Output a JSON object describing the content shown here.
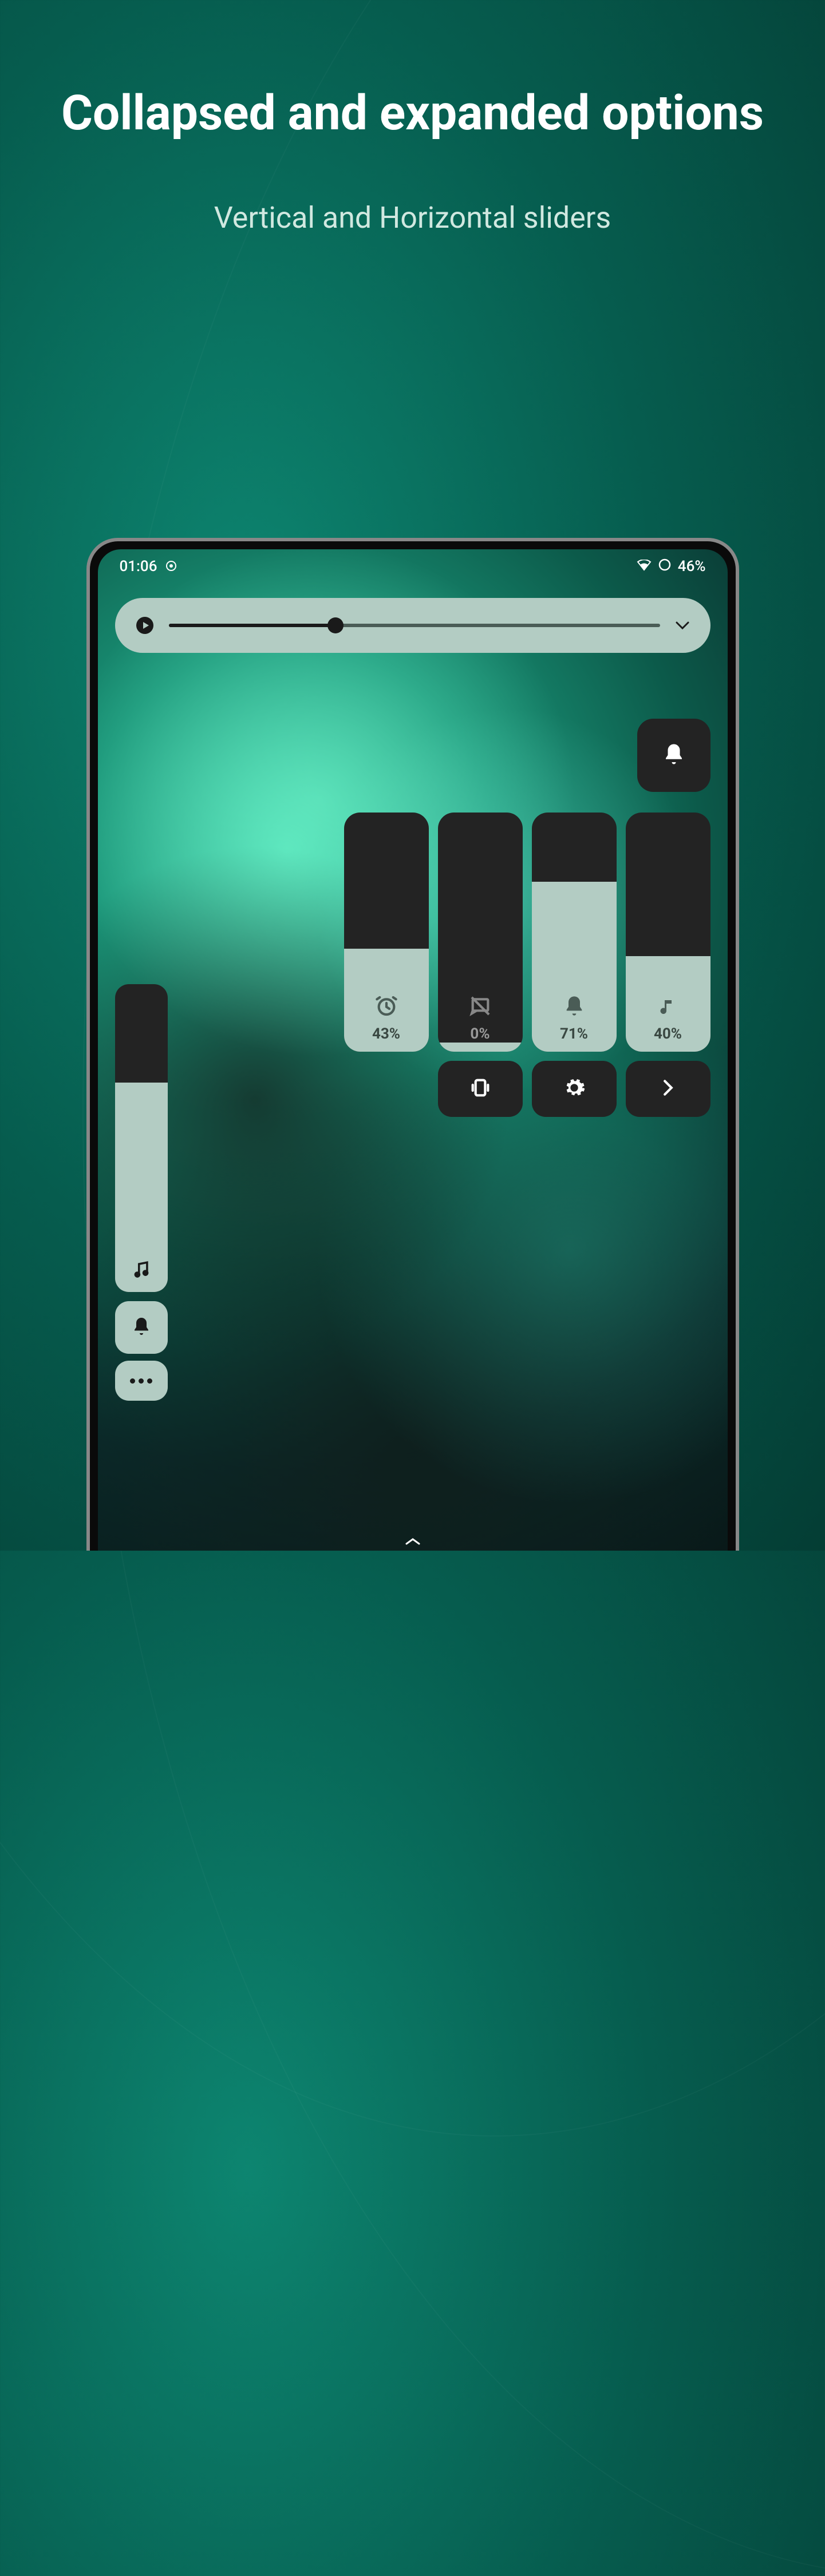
{
  "title": "Collapsed and expanded options",
  "subtitle": "Vertical and Horizontal sliders",
  "status": {
    "time": "01:06",
    "battery": "46%"
  },
  "horizontal_slider": {
    "position_pct": 34
  },
  "vertical_sliders": [
    {
      "icon": "alarm-icon",
      "value_pct": 43,
      "label": "43%"
    },
    {
      "icon": "chat-off-icon",
      "value_pct": 0,
      "label": "0%"
    },
    {
      "icon": "bell-icon",
      "value_pct": 71,
      "label": "71%"
    },
    {
      "icon": "music-note-icon",
      "value_pct": 40,
      "label": "40%"
    }
  ],
  "actions": [
    {
      "name": "vibrate-button",
      "icon": "vibrate-icon"
    },
    {
      "name": "settings-button",
      "icon": "settings-icon"
    },
    {
      "name": "next-button",
      "icon": "chevron-right-icon"
    }
  ],
  "collapsed": {
    "slider_pct": 68
  }
}
